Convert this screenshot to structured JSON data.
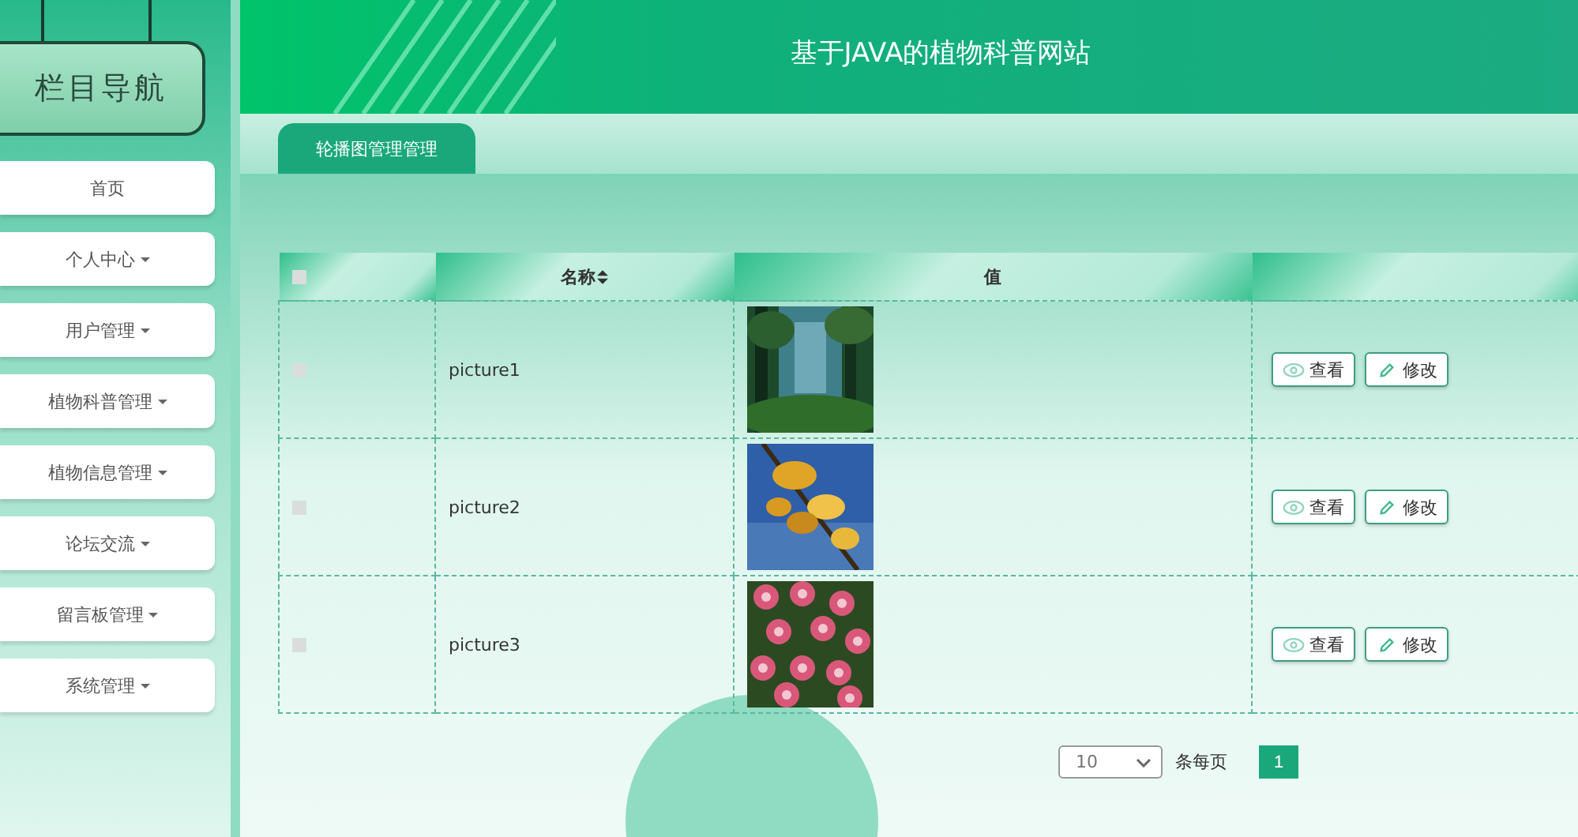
{
  "sidebar": {
    "title": "栏目导航",
    "items": [
      {
        "label": "首页",
        "has_menu": false
      },
      {
        "label": "个人中心",
        "has_menu": true
      },
      {
        "label": "用户管理",
        "has_menu": true
      },
      {
        "label": "植物科普管理",
        "has_menu": true
      },
      {
        "label": "植物信息管理",
        "has_menu": true
      },
      {
        "label": "论坛交流",
        "has_menu": true
      },
      {
        "label": "留言板管理",
        "has_menu": true
      },
      {
        "label": "系统管理",
        "has_menu": true
      }
    ]
  },
  "header": {
    "title": "基于JAVA的植物科普网站"
  },
  "tabs": [
    {
      "label": "轮播图管理管理",
      "selected": true
    }
  ],
  "table": {
    "select_all_checked": false,
    "columns": [
      "名称",
      "值"
    ],
    "sortable": [
      true,
      false
    ],
    "rows": [
      {
        "checked": false,
        "name": "picture1",
        "value": {
          "kind": "picture"
        },
        "actions": [
          "查看",
          "修改"
        ]
      },
      {
        "checked": false,
        "name": "picture2",
        "value": {
          "kind": "picture"
        },
        "actions": [
          "查看",
          "修改"
        ]
      },
      {
        "checked": false,
        "name": "picture3",
        "value": {
          "kind": "picture"
        },
        "actions": [
          "查看",
          "修改"
        ]
      }
    ]
  },
  "pagination": {
    "page_size": "10",
    "page_size_label": "条每页",
    "pages": [
      {
        "label": "1",
        "selected": true
      }
    ]
  }
}
